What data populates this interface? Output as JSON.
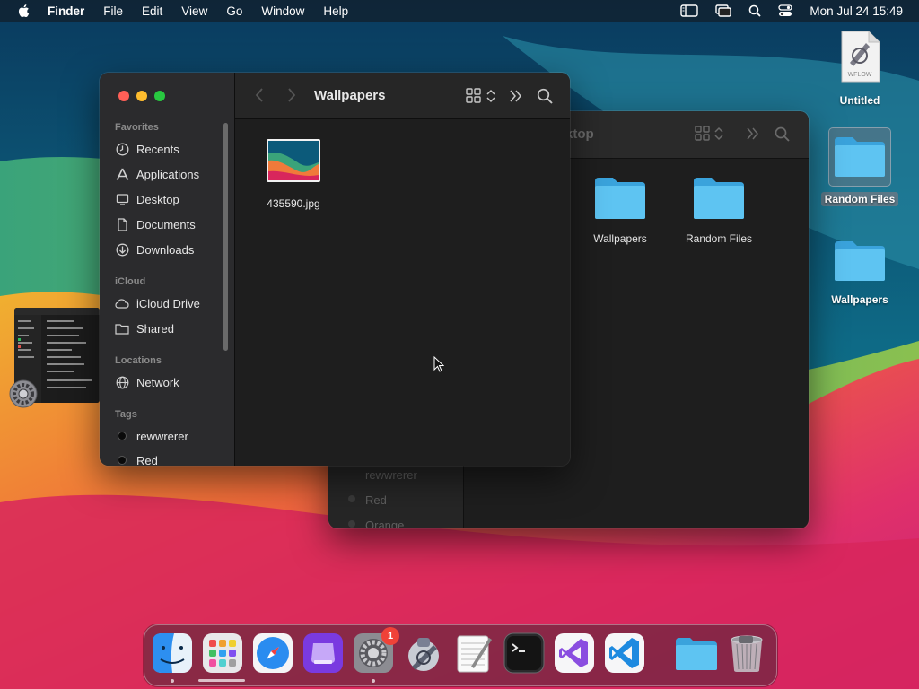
{
  "menubar": {
    "app_name": "Finder",
    "items": [
      "File",
      "Edit",
      "View",
      "Go",
      "Window",
      "Help"
    ],
    "clock": "Mon Jul 24  15:49"
  },
  "desktop": {
    "items": [
      {
        "label": "Untitled",
        "file_badge": "WFLOW"
      },
      {
        "label": "Random Files"
      },
      {
        "label": "Wallpapers"
      }
    ]
  },
  "back_window": {
    "title_fragment": "ktop",
    "folders": [
      {
        "label": "Wallpapers"
      },
      {
        "label": "Random Files"
      }
    ],
    "sidebar_tags": [
      "rewwrerer",
      "Red",
      "Orange"
    ]
  },
  "front_window": {
    "title": "Wallpapers",
    "sidebar": {
      "favorites_header": "Favorites",
      "favorites": [
        "Recents",
        "Applications",
        "Desktop",
        "Documents",
        "Downloads"
      ],
      "icloud_header": "iCloud",
      "icloud": [
        "iCloud Drive",
        "Shared"
      ],
      "locations_header": "Locations",
      "locations": [
        "Network"
      ],
      "tags_header": "Tags",
      "tags": [
        "rewwrerer",
        "Red"
      ]
    },
    "files": [
      {
        "name": "435590.jpg"
      }
    ]
  },
  "dock": {
    "apps": [
      "finder-icon",
      "launchpad-icon",
      "safari-icon",
      "podcasts-icon",
      "system-settings-icon",
      "automator-icon",
      "textedit-icon",
      "terminal-icon",
      "visual-studio-icon",
      "vscode-icon",
      "folder-icon",
      "trash-icon"
    ],
    "settings_badge": "1"
  },
  "colors": {
    "folder_blue": "#4fb8ee",
    "close": "#fe5f57",
    "minimize": "#febc2e",
    "zoom": "#28c840"
  }
}
